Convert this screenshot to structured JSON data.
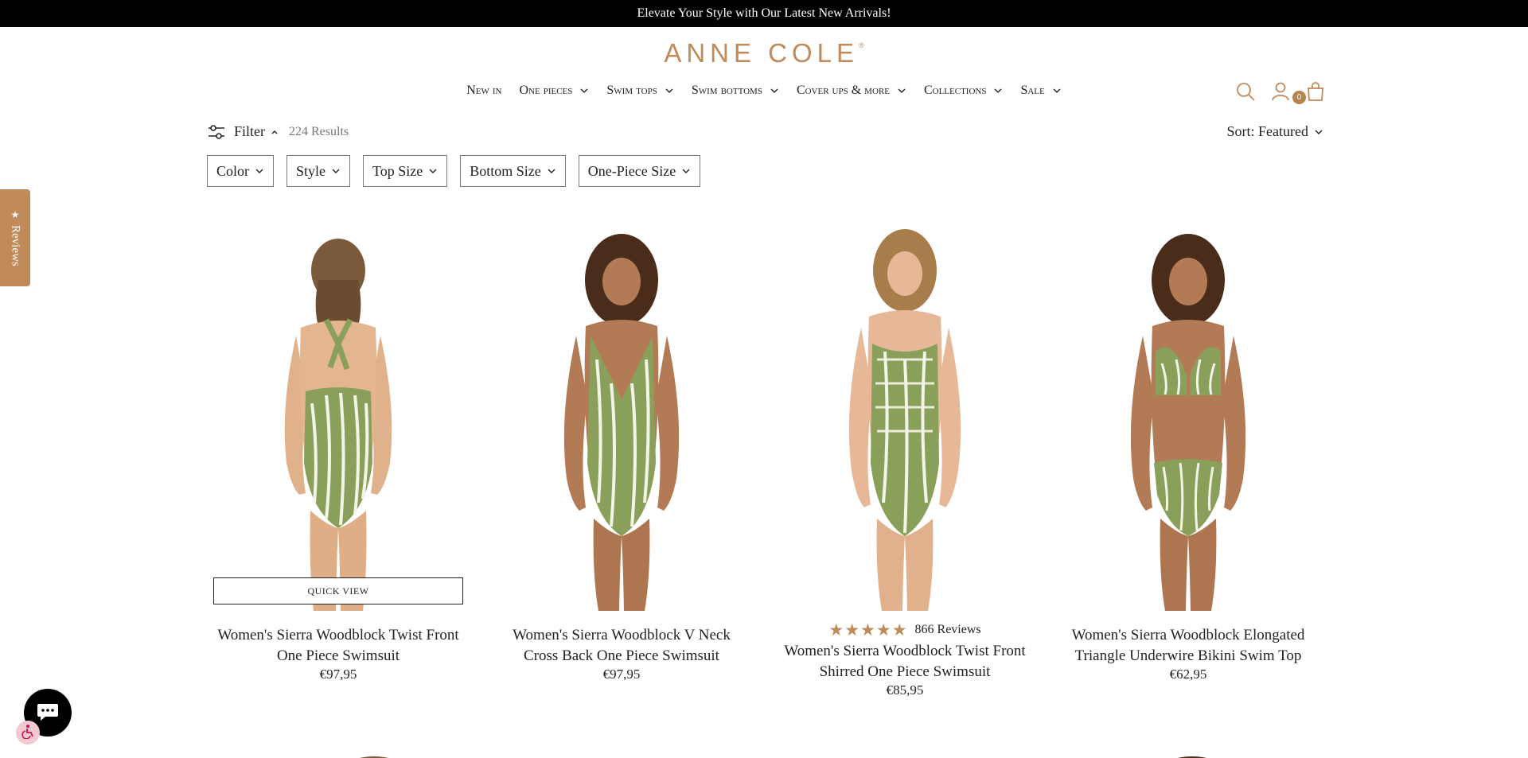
{
  "announcement": "Elevate Your Style with Our Latest New Arrivals!",
  "brand": {
    "name": "ANNE COLE",
    "mark": "®",
    "color": "#c08a5a"
  },
  "nav": {
    "items": [
      {
        "label": "New in",
        "has_dropdown": false
      },
      {
        "label": "One pieces",
        "has_dropdown": true
      },
      {
        "label": "Swim tops",
        "has_dropdown": true
      },
      {
        "label": "Swim bottoms",
        "has_dropdown": true
      },
      {
        "label": "Cover ups & more",
        "has_dropdown": true
      },
      {
        "label": "Collections",
        "has_dropdown": true
      },
      {
        "label": "Sale",
        "has_dropdown": true
      }
    ]
  },
  "header_icons": {
    "search": "search-icon",
    "account": "account-icon",
    "cart": "cart-icon",
    "cart_count": "0"
  },
  "filter": {
    "label": "Filter",
    "results": "224 Results"
  },
  "sort": {
    "label": "Sort: Featured"
  },
  "facets": [
    "Color",
    "Style",
    "Top Size",
    "Bottom Size",
    "One-Piece Size"
  ],
  "reviews_tab": {
    "label": "Reviews",
    "icon": "star-icon"
  },
  "products": [
    {
      "title": "Women's Sierra Woodblock Twist Front One Piece Swimsuit",
      "price": "€97,95",
      "quick_view": "QUICK VIEW"
    },
    {
      "title": "Women's Sierra Woodblock V Neck Cross Back One Piece Swimsuit",
      "price": "€97,95"
    },
    {
      "title": "Women's Sierra Woodblock Twist Front Shirred One Piece Swimsuit",
      "price": "€85,95",
      "rating": 5,
      "reviews": "866 Reviews"
    },
    {
      "title": "Women's Sierra Woodblock Elongated Triangle Underwire Bikini Swim Top",
      "price": "€62,95"
    }
  ],
  "floating": {
    "chat": "chat-icon",
    "accessibility": "accessibility-icon"
  },
  "colors": {
    "accent": "#c08a5a",
    "swim_print": "#8aa05a",
    "announcement_bg": "#000000"
  }
}
